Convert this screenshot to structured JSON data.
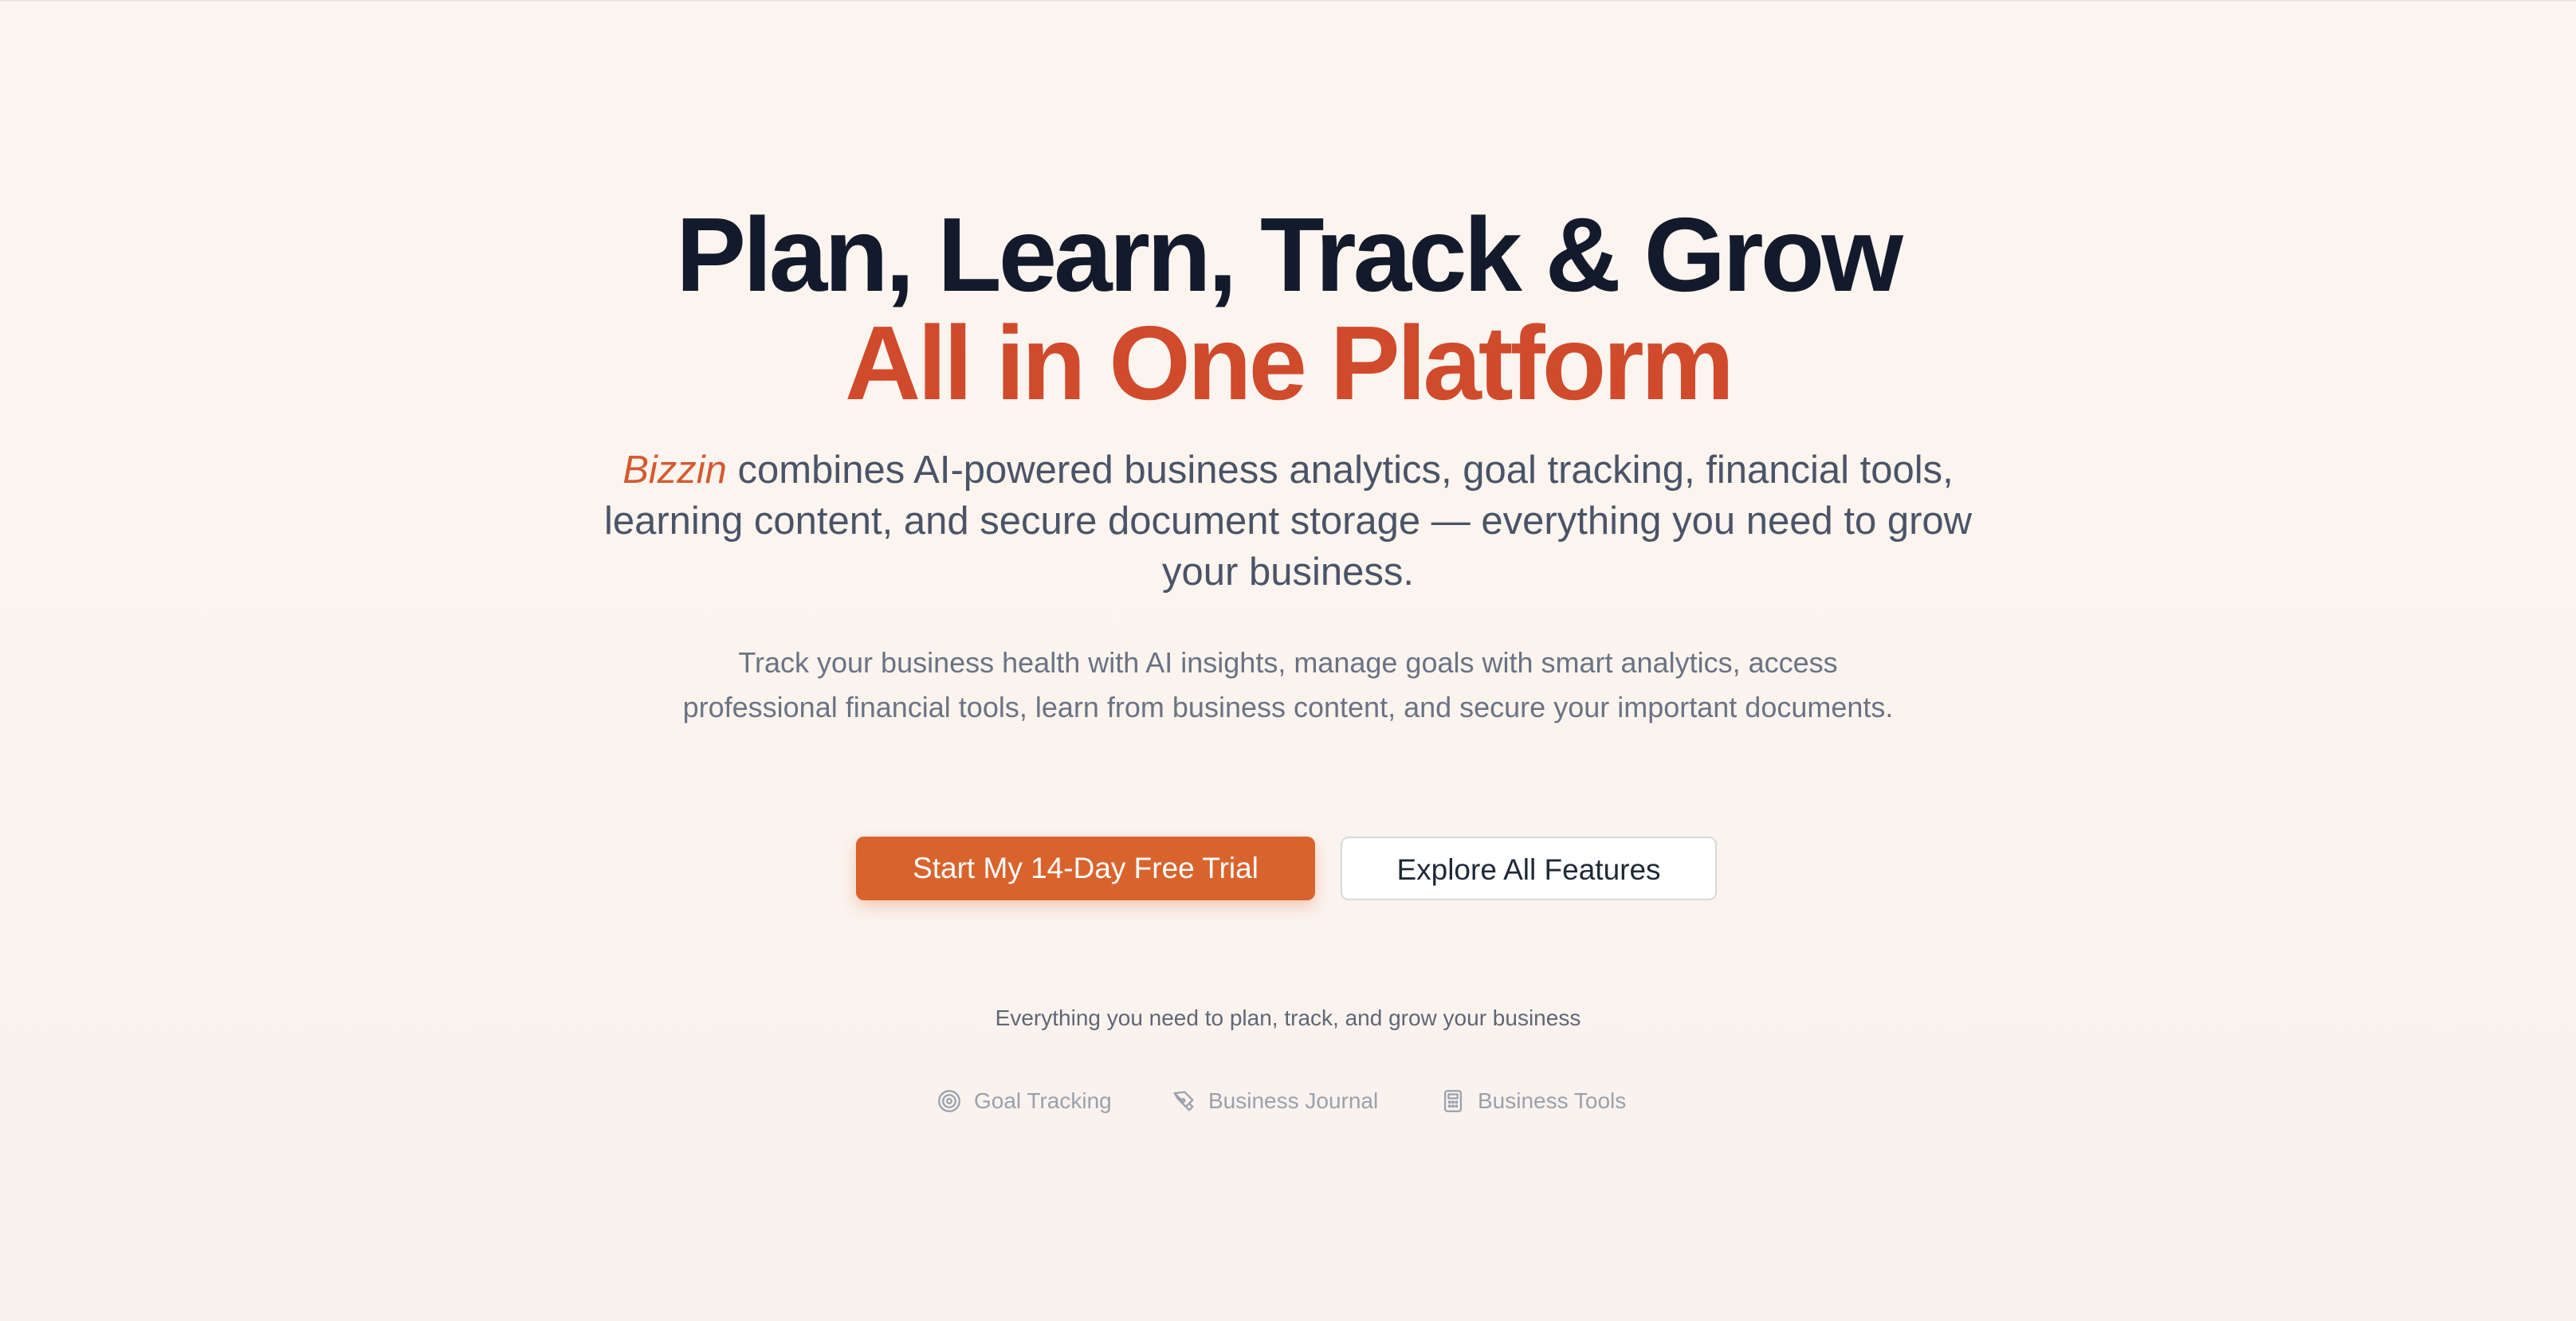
{
  "hero": {
    "headline_line1": "Plan, Learn, Track & Grow",
    "headline_line2": "All in One Platform",
    "brand_name": "Bizzin",
    "subtitle_rest": " combines AI-powered business analytics, goal tracking, financial tools, learning content, and secure document storage — everything you need to grow your business.",
    "description": "Track your business health with AI insights, manage goals with smart analytics, access professional financial tools, learn from business content, and secure your important documents."
  },
  "cta": {
    "primary_label": "Start My 14-Day Free Trial",
    "secondary_label": "Explore All Features"
  },
  "tagline": "Everything you need to plan, track, and grow your business",
  "features": [
    {
      "label": "Goal Tracking",
      "icon": "target-icon"
    },
    {
      "label": "Business Journal",
      "icon": "pen-icon"
    },
    {
      "label": "Business Tools",
      "icon": "calculator-icon"
    }
  ],
  "colors": {
    "accent": "#d9632d",
    "headline_dark": "#131a2c",
    "headline_accent": "#d04a2c",
    "background": "#fdf5ef"
  }
}
